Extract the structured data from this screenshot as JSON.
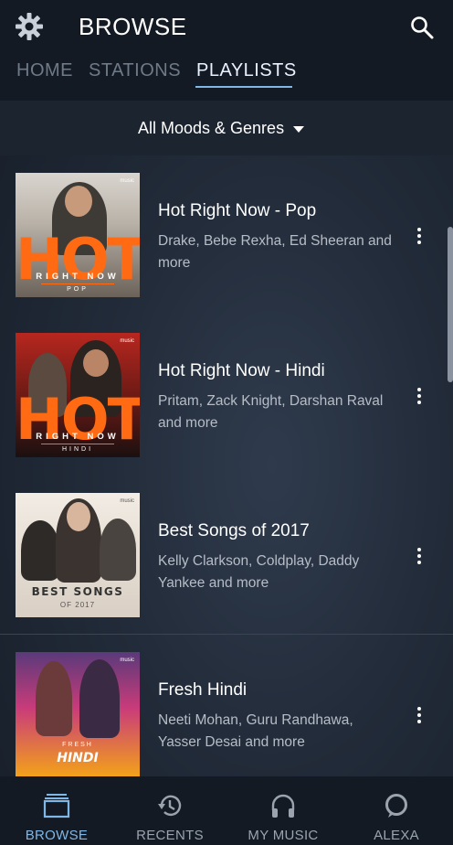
{
  "header": {
    "title": "BROWSE",
    "tabs": [
      {
        "label": "HOME"
      },
      {
        "label": "STATIONS"
      },
      {
        "label": "PLAYLISTS"
      }
    ],
    "active_tab": "PLAYLISTS"
  },
  "filter": {
    "label": "All Moods & Genres"
  },
  "playlists": [
    {
      "name": "Hot Right Now - Pop",
      "artists": "Drake, Bebe Rexha, Ed Sheeran and more",
      "art": {
        "word": "HOT",
        "sub1": "RIGHT NOW",
        "sub2": "POP",
        "badge": "music"
      }
    },
    {
      "name": "Hot Right Now - Hindi",
      "artists": "Pritam, Zack Knight, Darshan Raval and more",
      "art": {
        "word": "HOT",
        "sub1": "RIGHT NOW",
        "sub2": "HINDI",
        "badge": "music"
      }
    },
    {
      "name": "Best Songs of 2017",
      "artists": "Kelly Clarkson, Coldplay, Daddy Yankee and more",
      "art": {
        "word": "BEST SONGS",
        "sub2": "OF 2017",
        "badge": "music"
      }
    },
    {
      "name": "Fresh Hindi",
      "artists": "Neeti Mohan, Guru Randhawa, Yasser Desai and more",
      "art": {
        "sub1": "FRESH",
        "word": "HINDI",
        "badge": "music"
      }
    }
  ],
  "bottom_nav": [
    {
      "label": "BROWSE",
      "icon": "browse-icon",
      "active": true
    },
    {
      "label": "RECENTS",
      "icon": "recents-icon",
      "active": false
    },
    {
      "label": "MY MUSIC",
      "icon": "headphones-icon",
      "active": false
    },
    {
      "label": "ALEXA",
      "icon": "alexa-icon",
      "active": false
    }
  ],
  "colors": {
    "accent": "#7fb7e6",
    "background": "#1a2230",
    "header": "#131a24",
    "hot_orange": "#ff6a12"
  }
}
